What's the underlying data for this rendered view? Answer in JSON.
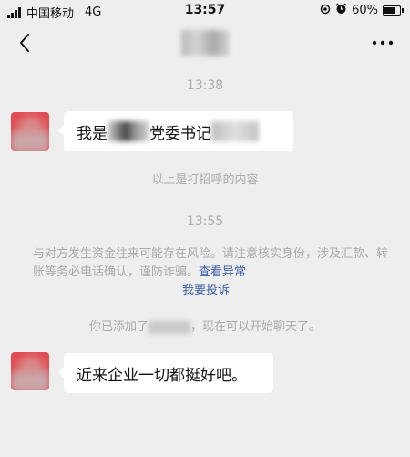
{
  "status_bar": {
    "carrier": "中国移动",
    "network": "4G",
    "time": "13:57",
    "battery": "60%"
  },
  "nav": {
    "back_icon": "chevron-left-icon",
    "more_icon": "more-dots-icon",
    "more_label": "..."
  },
  "chat": {
    "ts1": "13:38",
    "msg1_prefix": "我是",
    "msg1_suffix": "党委书记",
    "greeting_note": "以上是打招呼的内容",
    "ts2": "13:55",
    "warning_text": "与对方发生资金往来可能存在风险。请注意核实身份，涉及汇款、转账等务必电话确认，谨防诈骗。",
    "check_link": "查看异常",
    "report_link": "我要投诉",
    "added_prefix": "你已添加了",
    "added_suffix": "，现在可以开始聊天了。",
    "msg2": "近来企业一切都挺好吧。"
  },
  "colors": {
    "background": "#eeeeee",
    "bubble": "#ffffff",
    "link": "#3b5ea8",
    "muted_text": "#a9a9a9"
  }
}
